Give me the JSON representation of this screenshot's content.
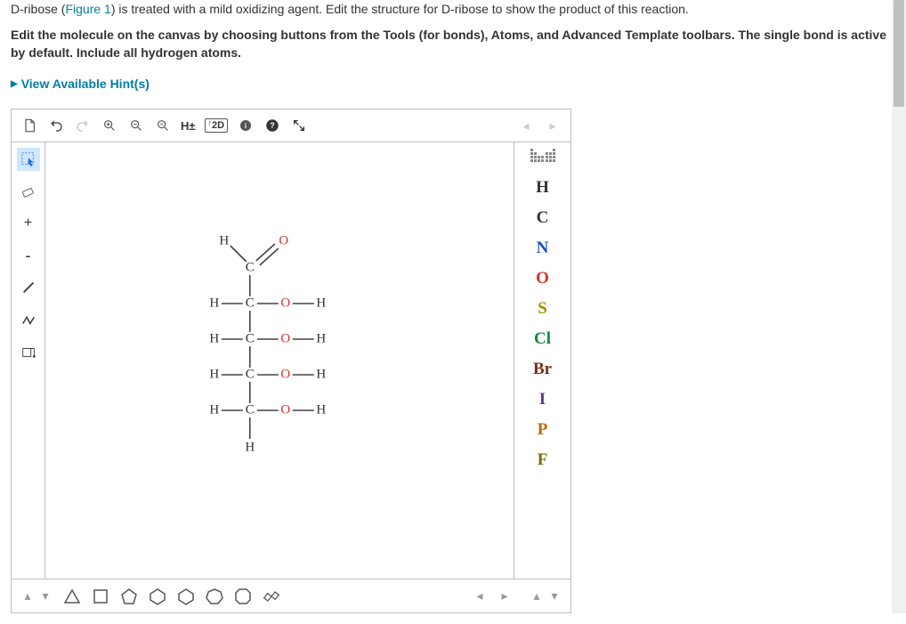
{
  "intro": {
    "before_link": "D-ribose (",
    "link": "Figure 1",
    "after_link": ") is treated with a mild oxidizing agent. Edit the structure for D-ribose to show the product of this reaction."
  },
  "instructions": "Edit the molecule on the canvas by choosing buttons from the Tools (for bonds), Atoms, and Advanced Template toolbars. The single bond is active by default. Include all hydrogen atoms.",
  "hints_label": "View Available Hint(s)",
  "top_toolbar": {
    "h_plusminus": "H±",
    "two_d": "2D"
  },
  "atoms": [
    {
      "label": "H",
      "color": "#333333"
    },
    {
      "label": "C",
      "color": "#333333"
    },
    {
      "label": "N",
      "color": "#1a4fbf"
    },
    {
      "label": "O",
      "color": "#d93030"
    },
    {
      "label": "S",
      "color": "#a88b00"
    },
    {
      "label": "Cl",
      "color": "#0f8a3c"
    },
    {
      "label": "Br",
      "color": "#7a2e1a"
    },
    {
      "label": "I",
      "color": "#5a3a8c"
    },
    {
      "label": "P",
      "color": "#c06a00"
    },
    {
      "label": "F",
      "color": "#7a6a00"
    }
  ],
  "molecule": {
    "top": {
      "H": "H",
      "C": "C",
      "O": "O"
    },
    "rows": [
      {
        "left": "H",
        "c": "C",
        "o": "O",
        "right": "H"
      },
      {
        "left": "H",
        "c": "C",
        "o": "O",
        "right": "H"
      },
      {
        "left": "H",
        "c": "C",
        "o": "O",
        "right": "H"
      },
      {
        "left": "H",
        "c": "C",
        "o": "O",
        "right": "H"
      }
    ],
    "bottom": "H"
  }
}
